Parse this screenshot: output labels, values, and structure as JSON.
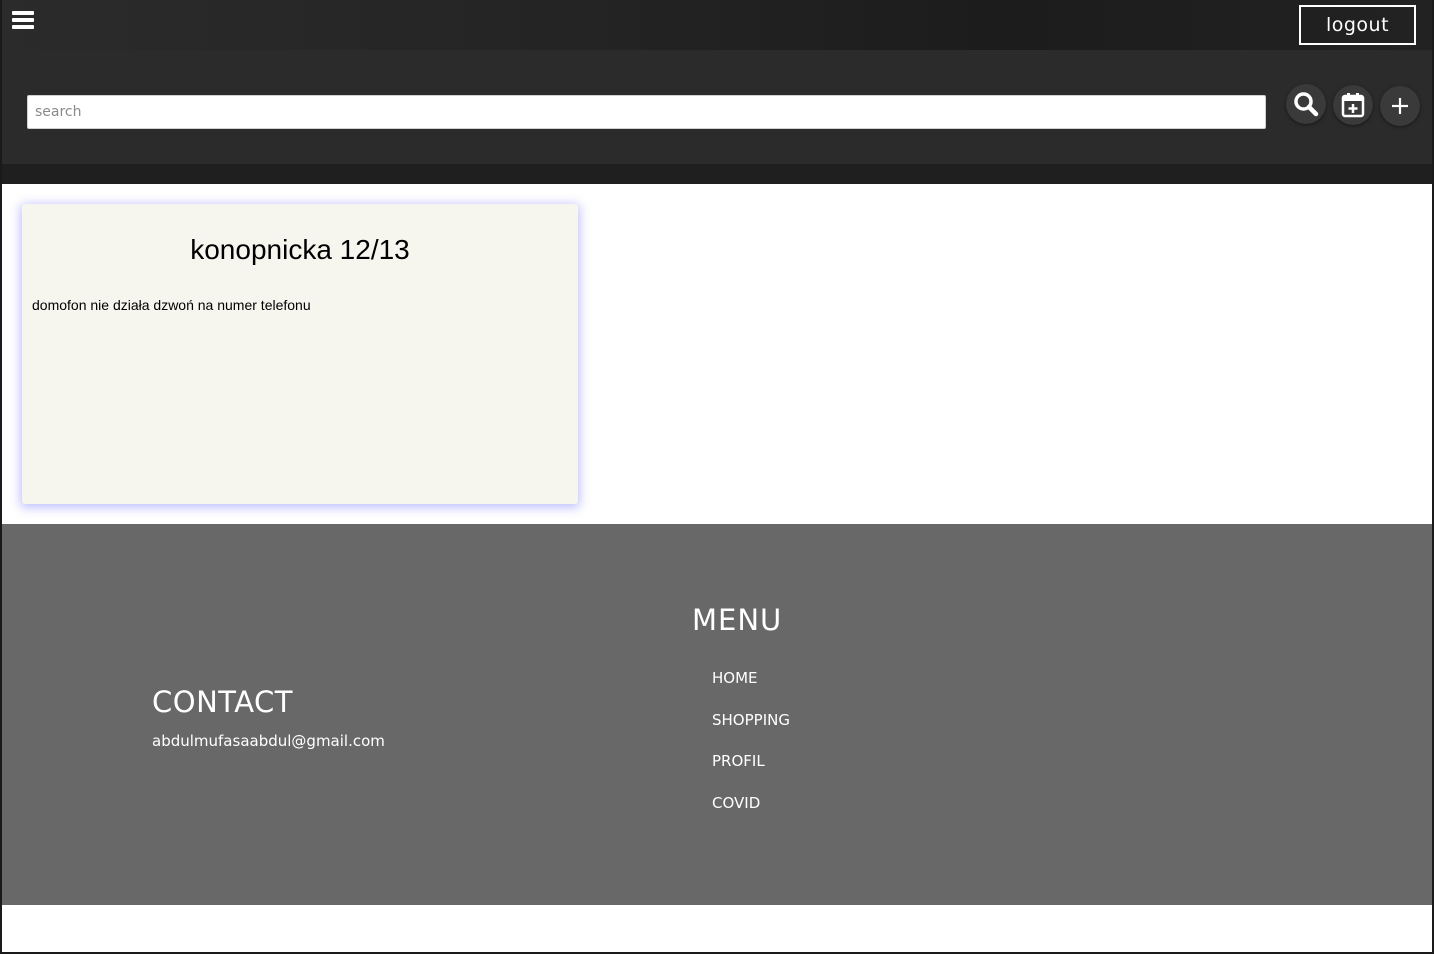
{
  "header": {
    "menu_icon": "hamburger-icon",
    "logout_label": "logout"
  },
  "search": {
    "placeholder": "search",
    "value": "",
    "buttons": [
      {
        "icon": "search-icon"
      },
      {
        "icon": "calendar-plus-icon"
      },
      {
        "icon": "plus-icon"
      }
    ]
  },
  "notes": [
    {
      "title": "konopnicka 12/13",
      "body": "domofon nie działa dzwoń na numer telefonu"
    }
  ],
  "footer": {
    "contact_title": "CONTACT",
    "contact_email": "abdulmufasaabdul@gmail.com",
    "menu_title": "MENU",
    "menu_items": [
      "HOME",
      "SHOPPING",
      "PROFIL",
      "COVID"
    ]
  },
  "colors": {
    "topbar": "#222222",
    "searchbar": "#2b2b2b",
    "card_bg": "#f6f5ee",
    "card_glow": "#7878ff",
    "footer_bg": "#686868"
  }
}
